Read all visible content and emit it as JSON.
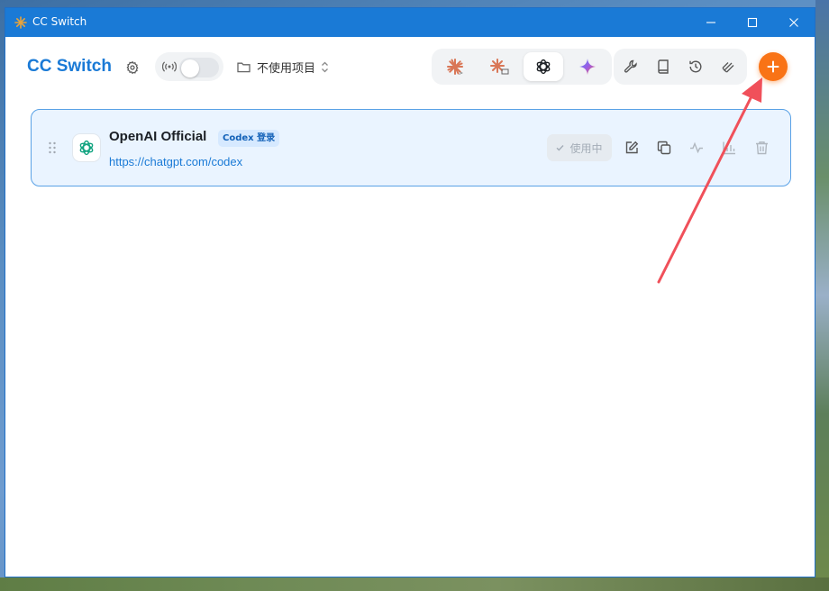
{
  "window": {
    "title": "CC Switch",
    "controls": [
      "minimize",
      "maximize",
      "close"
    ]
  },
  "header": {
    "app_title": "CC Switch",
    "settings_icon": "gear-icon",
    "proxy_toggle": {
      "icon": "broadcast-icon",
      "on": false
    },
    "project_selector": {
      "label": "不使用项目",
      "icon": "folder-icon"
    },
    "app_tabs": [
      {
        "name": "claude",
        "icon": "claude-icon",
        "active": false
      },
      {
        "name": "claude-desktop",
        "icon": "claude-desktop-icon",
        "active": false
      },
      {
        "name": "codex",
        "icon": "openai-icon",
        "active": true
      },
      {
        "name": "gemini",
        "icon": "gemini-icon",
        "active": false
      }
    ],
    "tools": [
      "wrench-icon",
      "book-icon",
      "history-icon",
      "stack-icon"
    ],
    "add_button": {
      "icon": "plus-icon"
    }
  },
  "providers": [
    {
      "name": "OpenAI Official",
      "badge": "Codex 登录",
      "url": "https://chatgpt.com/codex",
      "status_label": "使用中",
      "active": true
    }
  ],
  "colors": {
    "accent": "#1a7ad6",
    "add_button": "#f97316",
    "claude": "#d97757",
    "openai": "#10a37f",
    "annotation_arrow": "#f0505a"
  }
}
